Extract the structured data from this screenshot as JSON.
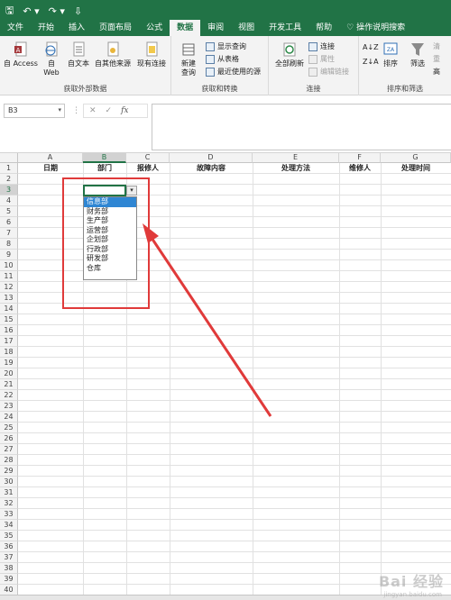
{
  "quick_access": {
    "save_icon": "save-icon",
    "undo_icon": "undo-icon",
    "redo_icon": "redo-icon"
  },
  "tabs": [
    {
      "label": "文件"
    },
    {
      "label": "开始"
    },
    {
      "label": "插入"
    },
    {
      "label": "页面布局"
    },
    {
      "label": "公式"
    },
    {
      "label": "数据"
    },
    {
      "label": "审阅"
    },
    {
      "label": "视图"
    },
    {
      "label": "开发工具"
    },
    {
      "label": "帮助"
    },
    {
      "label": "操作说明搜索"
    }
  ],
  "active_tab": "数据",
  "ribbon": {
    "get_external": {
      "label": "获取外部数据",
      "buttons": [
        "自 Access",
        "自\nWeb",
        "自文本",
        "自其他来源",
        "现有连接"
      ]
    },
    "get_transform": {
      "label": "获取和转换",
      "new_query": "新建\n查询",
      "small": [
        "显示查询",
        "从表格",
        "最近使用的源"
      ]
    },
    "connections": {
      "label": "连接",
      "refresh_all": "全部刷新",
      "small": [
        "连接",
        "属性",
        "编辑链接"
      ]
    },
    "sort_filter": {
      "label": "排序和筛选",
      "sort": "排序",
      "filter": "筛选",
      "partial": [
        "清",
        "重",
        "高"
      ]
    }
  },
  "formula_bar": {
    "name_box": "B3",
    "cancel": "✕",
    "enter": "✓",
    "fx": "fx"
  },
  "columns": [
    "A",
    "B",
    "C",
    "D",
    "E",
    "F",
    "G"
  ],
  "header_row": [
    "日期",
    "部门",
    "报修人",
    "故障内容",
    "处理方法",
    "维修人",
    "处理时间"
  ],
  "rows": [
    "1",
    "2",
    "3",
    "4",
    "5",
    "6",
    "7",
    "8",
    "9",
    "10",
    "11",
    "12",
    "13",
    "14",
    "15",
    "16",
    "17",
    "18",
    "19",
    "20",
    "21",
    "22",
    "23",
    "24",
    "25",
    "26",
    "27",
    "28",
    "29",
    "30",
    "31",
    "32",
    "33",
    "34",
    "35",
    "36",
    "37",
    "38",
    "39",
    "40"
  ],
  "dropdown": {
    "options": [
      "信息部",
      "财务部",
      "生产部",
      "运营部",
      "企划部",
      "行政部",
      "研发部",
      "仓库"
    ],
    "highlighted_index": 0,
    "arrow": "▾"
  },
  "annotation_color": "#e03a3a",
  "watermark": "Bai 经验",
  "watermark_sub": "jingyan.baidu.com"
}
